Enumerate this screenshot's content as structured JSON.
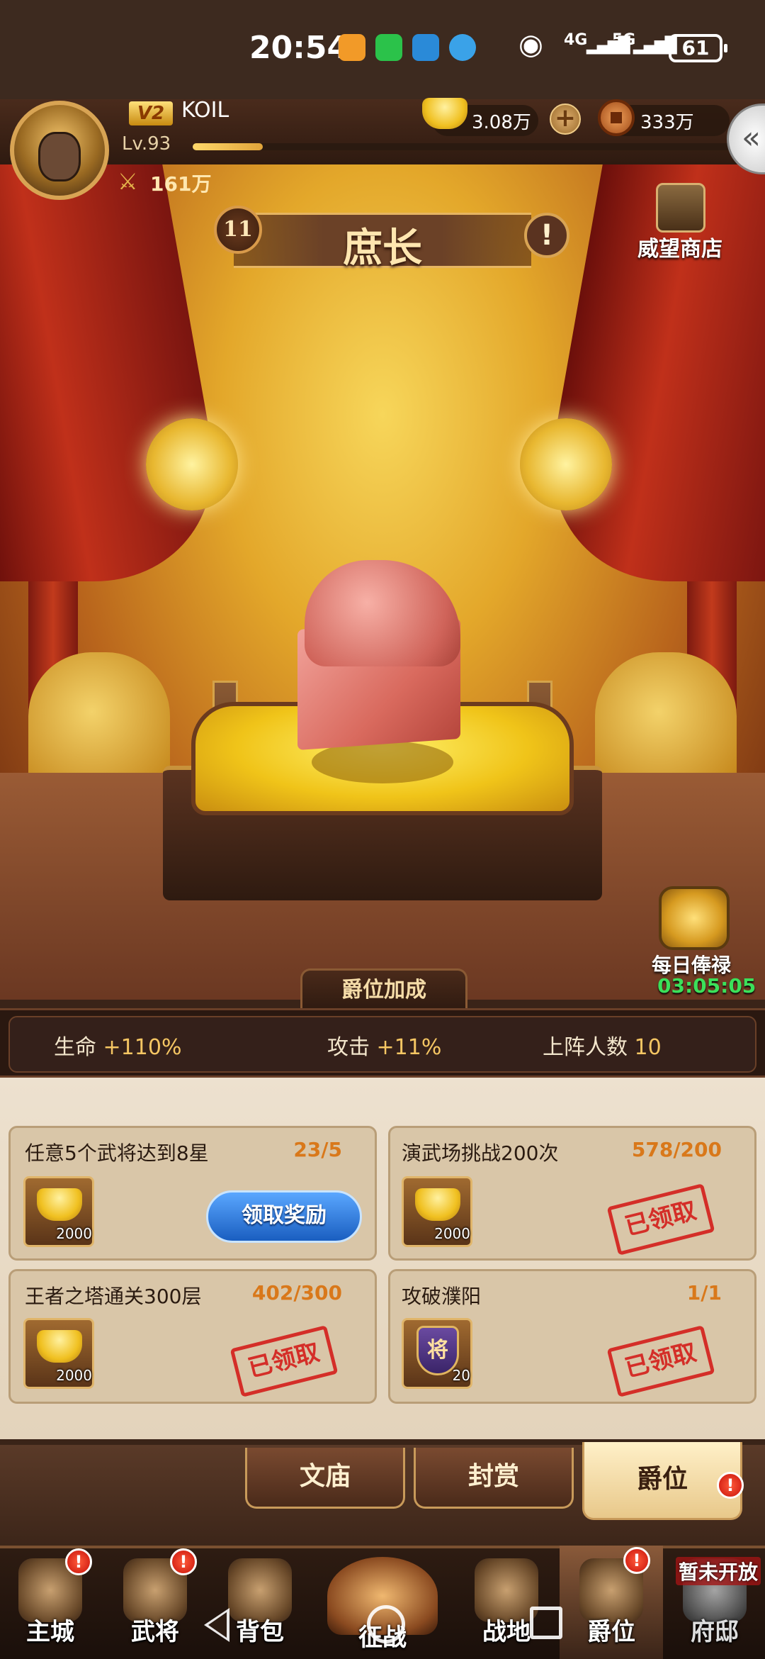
{
  "status_bar": {
    "time": "20:54",
    "network1": "4G",
    "network2": "5G",
    "battery": "61"
  },
  "player": {
    "vip": "V2",
    "name": "KOIL",
    "level": "Lv.93",
    "exp_fraction": 0.13,
    "power": "161万"
  },
  "currency": {
    "gold": "3.08万",
    "coins": "333万",
    "plus_label": "+"
  },
  "shop": {
    "label": "威望商店"
  },
  "rank": {
    "level": "11",
    "title": "庶长",
    "info_label": "!"
  },
  "daily_salary": {
    "label": "每日俸禄",
    "timer": "03:05:05"
  },
  "bonus": {
    "tab_label": "爵位加成",
    "hp_label": "生命",
    "hp_value": "+110%",
    "atk_label": "攻击",
    "atk_value": "+11%",
    "team_label": "上阵人数",
    "team_value": "10"
  },
  "tasks": [
    {
      "title": "任意5个武将达到8星",
      "progress": "23/5",
      "reward_count": "2000",
      "reward": "gold-ingot",
      "action": "领取奖励",
      "status": "claimable"
    },
    {
      "title": "演武场挑战200次",
      "progress": "578/200",
      "reward_count": "2000",
      "reward": "gold-ingot",
      "action": "已领取",
      "status": "claimed"
    },
    {
      "title": "王者之塔通关300层",
      "progress": "402/300",
      "reward_count": "2000",
      "reward": "gold-ingot",
      "action": "已领取",
      "status": "claimed"
    },
    {
      "title": "攻破濮阳",
      "progress": "1/1",
      "reward_count": "20",
      "reward": "general-token",
      "reward_glyph": "将",
      "action": "已领取",
      "status": "claimed"
    }
  ],
  "subtabs": [
    {
      "label": "文庙"
    },
    {
      "label": "封赏"
    },
    {
      "label": "爵位",
      "active": true,
      "badge": "!"
    }
  ],
  "bottom_nav": [
    {
      "label": "主城",
      "badge": "!"
    },
    {
      "label": "武将",
      "badge": "!"
    },
    {
      "label": "背包"
    },
    {
      "label": "征战"
    },
    {
      "label": "战地"
    },
    {
      "label": "爵位",
      "badge": "!",
      "active": true
    },
    {
      "label": "府邸",
      "note": "暂未开放"
    }
  ],
  "colors": {
    "accent_gold": "#f5c663",
    "progress_orange": "#d9781a",
    "claim_blue": "#1a5ec0",
    "stamp_red": "#d4221e",
    "timer_green": "#3be05a"
  }
}
